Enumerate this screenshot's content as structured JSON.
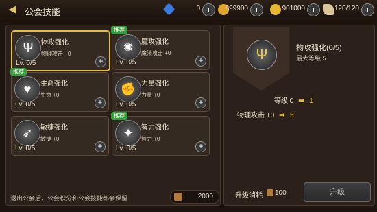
{
  "header": {
    "title": "公会技能",
    "currencies": [
      {
        "icon": "gem-icon",
        "value": "0",
        "color": "#3a7adf"
      },
      {
        "icon": "gold-coin-stack-icon",
        "value": "899900",
        "color": "#e2a52a"
      },
      {
        "icon": "guild-coin-icon",
        "value": "901000",
        "color": "#e6b832"
      },
      {
        "icon": "stamina-icon",
        "value": "120/120",
        "color": "#d9c79a"
      }
    ]
  },
  "skills": [
    {
      "name": "物攻强化",
      "stat": "物理攻击 +0",
      "level": "Lv. 0/5",
      "badge": "",
      "icon": "trident-icon",
      "selected": true
    },
    {
      "name": "魔攻强化",
      "stat": "魔法攻击 +0",
      "level": "Lv. 0/5",
      "badge": "推荐",
      "icon": "magic-swirl-icon",
      "selected": false
    },
    {
      "name": "生命强化",
      "stat": "生命 +0",
      "level": "Lv. 0/5",
      "badge": "推荐",
      "icon": "heart-icon",
      "selected": false
    },
    {
      "name": "力量强化",
      "stat": "力量 +0",
      "level": "Lv. 0/5",
      "badge": "",
      "icon": "fist-icon",
      "selected": false
    },
    {
      "name": "敏捷强化",
      "stat": "敏捷 +0",
      "level": "Lv. 0/5",
      "badge": "",
      "icon": "agility-icon",
      "selected": false
    },
    {
      "name": "智力强化",
      "stat": "智力 +0",
      "level": "Lv. 0/5",
      "badge": "推荐",
      "icon": "intellect-icon",
      "selected": false
    }
  ],
  "footer": {
    "note": "退出公会后，公会积分和公会技能都会保留",
    "points": "2000"
  },
  "detail": {
    "name": "物攻强化(0/5)",
    "max_level": "最大等级 5",
    "level_label": "等级",
    "level_current": "0",
    "level_next": "1",
    "stat_label": "物理攻击 +0",
    "stat_next": "5",
    "cost_label": "升级消耗",
    "cost_value": "100",
    "upgrade_label": "升级"
  }
}
